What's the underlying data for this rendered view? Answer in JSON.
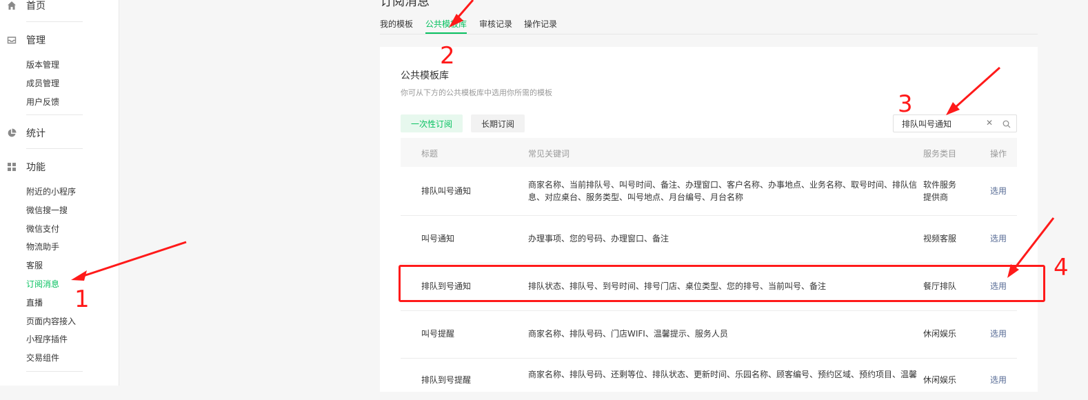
{
  "sidebar": {
    "home": {
      "label": "首页",
      "icon": "home-icon"
    },
    "manage": {
      "label": "管理",
      "icon": "inbox-icon",
      "items": [
        {
          "label": "版本管理"
        },
        {
          "label": "成员管理"
        },
        {
          "label": "用户反馈"
        }
      ]
    },
    "stats": {
      "label": "统计",
      "icon": "pie-chart-icon"
    },
    "features": {
      "label": "功能",
      "icon": "grid-icon",
      "items": [
        {
          "label": "附近的小程序"
        },
        {
          "label": "微信搜一搜"
        },
        {
          "label": "微信支付"
        },
        {
          "label": "物流助手"
        },
        {
          "label": "客服"
        },
        {
          "label": "订阅消息",
          "active": true
        },
        {
          "label": "直播"
        },
        {
          "label": "页面内容接入"
        },
        {
          "label": "小程序插件"
        },
        {
          "label": "交易组件"
        }
      ]
    }
  },
  "header": {
    "title_fragment": "订阅消息"
  },
  "tabs": [
    {
      "label": "我的模板"
    },
    {
      "label": "公共模板库",
      "active": true
    },
    {
      "label": "审核记录"
    },
    {
      "label": "操作记录"
    }
  ],
  "card": {
    "title": "公共模板库",
    "description": "你可从下方的公共模板库中选用你所需的模板",
    "filters": {
      "once": "一次性订阅",
      "long": "长期订阅"
    },
    "search": {
      "value": "排队叫号通知",
      "placeholder": ""
    },
    "table": {
      "headers": {
        "title": "标题",
        "keywords": "常见关键词",
        "category": "服务类目",
        "action": "操作"
      },
      "rows": [
        {
          "title": "排队叫号通知",
          "keywords": "商家名称、当前排队号、叫号时间、备注、办理窗口、客户名称、办事地点、业务名称、取号时间、排队信息、对应桌台、服务类型、叫号地点、月台编号、月台名称",
          "category": "软件服务提供商",
          "action": "选用"
        },
        {
          "title": "叫号通知",
          "keywords": "办理事项、您的号码、办理窗口、备注",
          "category": "视频客服",
          "action": "选用"
        },
        {
          "title": "排队到号通知",
          "keywords": "排队状态、排队号、到号时间、排号门店、桌位类型、您的排号、当前叫号、备注",
          "category": "餐厅排队",
          "action": "选用"
        },
        {
          "title": "叫号提醒",
          "keywords": "商家名称、排队号码、门店WIFI、温馨提示、服务人员",
          "category": "休闲娱乐",
          "action": "选用"
        },
        {
          "title": "排队到号提醒",
          "keywords": "商家名称、排队号码、还剩等位、排队状态、更新时间、乐园名称、顾客编号、预约区域、预约项目、温馨",
          "category": "休闲娱乐",
          "action": "选用"
        }
      ]
    }
  },
  "annotations": {
    "step1": "1",
    "step2": "2",
    "step3": "3",
    "step4": "4",
    "color": "#ff1a1a"
  },
  "colors": {
    "accent": "#07c160",
    "link": "#576b95"
  }
}
